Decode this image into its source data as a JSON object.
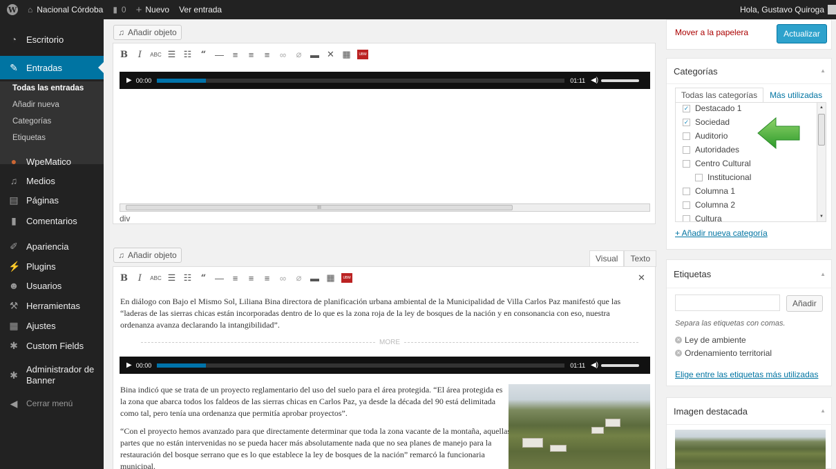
{
  "adminbar": {
    "site_name": "Nacional Córdoba",
    "comments_count": "0",
    "new_label": "Nuevo",
    "view_post_label": "Ver entrada",
    "greeting": "Hola, Gustavo Quiroga",
    "wp_logo_char": "W"
  },
  "sidebar": {
    "escritorio": "Escritorio",
    "entradas": "Entradas",
    "sub": {
      "todas": "Todas las entradas",
      "anadir": "Añadir nueva",
      "categorias": "Categorías",
      "etiquetas": "Etiquetas"
    },
    "wpematico": "WpeMatico",
    "medios": "Medios",
    "paginas": "Páginas",
    "comentarios": "Comentarios",
    "apariencia": "Apariencia",
    "plugins": "Plugins",
    "usuarios": "Usuarios",
    "herramientas": "Herramientas",
    "ajustes": "Ajustes",
    "custom_fields": "Custom Fields",
    "banner_line1": "Administrador de",
    "banner_line2": "Banner",
    "collapse": "Cerrar menú"
  },
  "editor1": {
    "add_media": "Añadir objeto",
    "player_start": "00:00",
    "player_end": "01:11",
    "player_progress": 0.03,
    "path": "div",
    "scroll_glyph": "III"
  },
  "editor2": {
    "add_media": "Añadir objeto",
    "tab_visual": "Visual",
    "tab_text": "Texto",
    "para1": "En diálogo con Bajo el Mismo Sol, Liliana Bina directora de planificación urbana ambiental de la Municipalidad de Villa Carlos Paz manifestó que las “laderas de las sierras chicas están incorporadas dentro de lo que es la zona roja de la ley de bosques de la nación y en consonancia con eso, nuestra ordenanza avanza declarando la intangibilidad”.",
    "more": "MORE",
    "player_start": "00:00",
    "player_end": "01:11",
    "player_progress": 0.03,
    "para2": "Bina indicó que se trata de un proyecto reglamentario del uso del suelo para el área protegida. “El área protegida es la zona que abarca todos los faldeos de las sierras chicas en Carlos Paz, ya desde la década del 90 está delimitada como tal, pero tenía una ordenanza que permitía aprobar proyectos”.",
    "para3": "“Con el proyecto hemos avanzado para que directamente determinar que toda la zona vacante de la montaña, aquellas partes que no están intervenidas no se pueda hacer más absolutamente nada que no sea planes de manejo para la restauración del bosque serrano que es lo que establece la ley de bosques de la nación” remarcó la funcionaria municipal."
  },
  "publish": {
    "trash": "Mover a la papelera",
    "update": "Actualizar"
  },
  "categories": {
    "title": "Categorías",
    "tab_all": "Todas las categorías",
    "tab_popular": "Más utilizadas",
    "items": [
      {
        "label": "Destacado 1",
        "checked": true
      },
      {
        "label": "Sociedad",
        "checked": true
      },
      {
        "label": "Auditorio",
        "checked": false
      },
      {
        "label": "Autoridades",
        "checked": false
      },
      {
        "label": "Centro Cultural",
        "checked": false
      },
      {
        "label": "Institucional",
        "checked": false
      },
      {
        "label": "Columna 1",
        "checked": false
      },
      {
        "label": "Columna 2",
        "checked": false
      },
      {
        "label": "Cultura",
        "checked": false
      }
    ],
    "add_new": "+ Añadir nueva categoría"
  },
  "tags": {
    "title": "Etiquetas",
    "input_value": "",
    "add": "Añadir",
    "hint": "Separa las etiquetas con comas.",
    "items": [
      "Ley de ambiente",
      "Ordenamiento territorial"
    ],
    "choose": "Elige entre las etiquetas más utilizadas"
  },
  "featured": {
    "title": "Imagen destacada"
  },
  "colors": {
    "adminbar": "#222222",
    "menu_active": "#0074a2",
    "primary": "#2ea2cc",
    "trash": "#aa0000",
    "arrow": "#3aaa35"
  }
}
